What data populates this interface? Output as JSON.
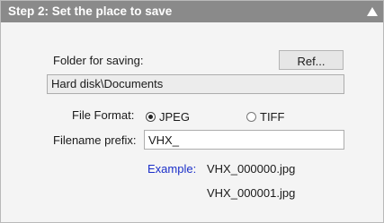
{
  "header": {
    "title": "Step 2: Set the place to save"
  },
  "folder": {
    "label": "Folder for saving:",
    "ref_button": "Ref...",
    "path": "Hard disk\\Documents"
  },
  "file_format": {
    "label": "File Format:",
    "options": [
      {
        "label": "JPEG",
        "selected": true
      },
      {
        "label": "TIFF",
        "selected": false
      }
    ]
  },
  "prefix": {
    "label": "Filename prefix:",
    "value": "VHX_"
  },
  "example": {
    "label": "Example:",
    "files": [
      "VHX_000000.jpg",
      "VHX_000001.jpg"
    ]
  },
  "colors": {
    "header_bg": "#8a8a8a",
    "panel_bg": "#f4f4f4",
    "example_label": "#1b2fc9"
  },
  "icons": {
    "collapse": "triangle-up-icon"
  }
}
